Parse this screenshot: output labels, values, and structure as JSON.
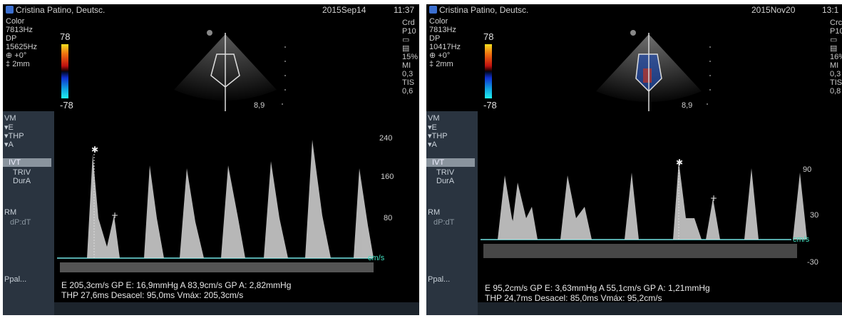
{
  "left": {
    "header": "Cristina Patino, Deutsc.",
    "date": "2015Sep14",
    "time": "11:37",
    "params": [
      "Color",
      "7813Hz",
      "DP",
      "15625Hz",
      "+0°",
      "2mm"
    ],
    "color_max": "78",
    "color_min": "-78",
    "right_col": [
      "Crd",
      "P10",
      "",
      "",
      "15%",
      "MI",
      "0,3",
      "TIS",
      "0,6"
    ],
    "depth_label": "8,9",
    "menu": [
      "VM",
      "E",
      "THP",
      "A",
      "IVT",
      "TRIV",
      "DurA",
      "RM",
      "dP:dT",
      "Ppal..."
    ],
    "menu_selected": 4,
    "scale": [
      "240",
      "160",
      "80"
    ],
    "unit": "cm/s",
    "meas_line1": "E 205,3cm/s  GP E: 16,9mmHg   A 83,9cm/s  GP A: 2,82mmHg",
    "meas_line2": "THP 27,6ms  Desacel: 95,0ms  Vmáx: 205,3cm/s"
  },
  "right": {
    "header": "Cristina Patino, Deutsc.",
    "date": "2015Nov20",
    "time": "13:1",
    "params": [
      "Color",
      "7813Hz",
      "DP",
      "10417Hz",
      "+0°",
      "2mm"
    ],
    "color_max": "78",
    "color_min": "-78",
    "right_col": [
      "Crc",
      "P10",
      "",
      "",
      "16%",
      "MI",
      "0,3",
      "TIS",
      "0,8"
    ],
    "depth_label": "8,9",
    "menu": [
      "VM",
      "E",
      "THP",
      "A",
      "IVT",
      "TRIV",
      "DurA",
      "RM",
      "dP:dT",
      "Ppal..."
    ],
    "menu_selected": 4,
    "scale": [
      "90",
      "30",
      "-30"
    ],
    "unit": "cm/s",
    "meas_line1": "E 95,2cm/s  GP E: 3,63mmHg    A 55,1cm/s  GP A: 1,21mmHg",
    "meas_line2": "THP 24,7ms  Desacel: 85,0ms  Vmáx: 95,2cm/s"
  }
}
